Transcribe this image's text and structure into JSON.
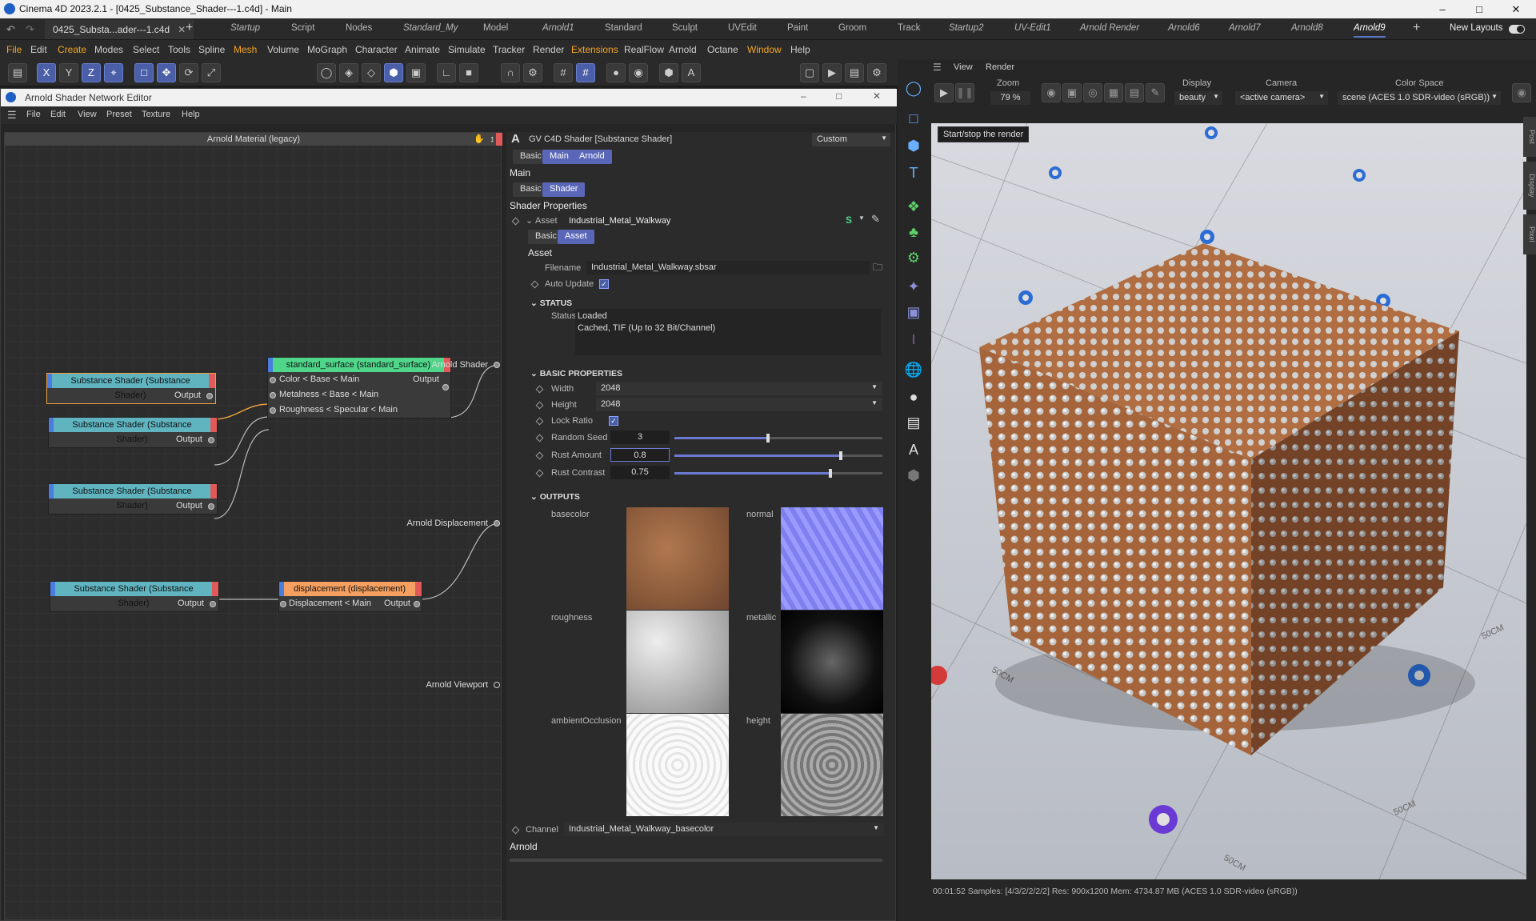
{
  "window": {
    "title": "Cinema 4D 2023.2.1 - [0425_Substance_Shader---1.c4d] - Main",
    "doc_tab": "0425_Substa...ader---1.c4d"
  },
  "layouts": [
    "Startup",
    "Script",
    "Nodes",
    "Standard_My",
    "Model",
    "Arnold1",
    "Standard",
    "Sculpt",
    "UVEdit",
    "Paint",
    "Groom",
    "Track",
    "Startup2",
    "UV-Edit1",
    "Arnold Render",
    "Arnold6",
    "Arnold7",
    "Arnold8",
    "Arnold9"
  ],
  "new_layouts": "New Layouts",
  "menu": [
    "File",
    "Edit",
    "Create",
    "Modes",
    "Select",
    "Tools",
    "Spline",
    "Mesh",
    "Volume",
    "MoGraph",
    "Character",
    "Animate",
    "Simulate",
    "Tracker",
    "Render",
    "Extensions",
    "RealFlow",
    "Arnold",
    "Octane",
    "Window",
    "Help"
  ],
  "editor": {
    "title": "Arnold Shader Network Editor",
    "menu": [
      "File",
      "Edit",
      "View",
      "Preset",
      "Texture",
      "Help"
    ],
    "graph_title": "Arnold Material (legacy)",
    "nodes": {
      "sub1": {
        "title": "Substance Shader (Substance Shader)",
        "out": "Output"
      },
      "sub2": {
        "title": "Substance Shader (Substance Shader)",
        "out": "Output"
      },
      "sub3": {
        "title": "Substance Shader (Substance Shader)",
        "out": "Output"
      },
      "sub4": {
        "title": "Substance Shader (Substance Shader)",
        "out": "Output"
      },
      "surface": {
        "title": "standard_surface (standard_surface)",
        "in1": "Color < Base < Main",
        "in2": "Metalness < Base < Main",
        "in3": "Roughness < Specular < Main",
        "out": "Output"
      },
      "disp": {
        "title": "displacement (displacement)",
        "in1": "Displacement < Main",
        "out": "Output"
      }
    },
    "outputs": {
      "shader": "Arnold Shader",
      "displacement": "Arnold Displacement",
      "viewport": "Arnold Viewport"
    }
  },
  "attr": {
    "header": "GV C4D Shader [Substance Shader]",
    "preset": "Custom",
    "tabs": [
      "Basic",
      "Main",
      "Arnold"
    ],
    "main_title": "Main",
    "sub_tabs": [
      "Basic",
      "Shader"
    ],
    "shader_props": "Shader Properties",
    "asset_label": "Asset",
    "asset_value": "Industrial_Metal_Walkway",
    "asset_tabs": [
      "Basic",
      "Asset"
    ],
    "asset_title": "Asset",
    "filename_label": "Filename",
    "filename": "Industrial_Metal_Walkway.sbsar",
    "auto_update": "Auto Update",
    "status_section": "STATUS",
    "status_label": "Status",
    "status_line1": "Loaded",
    "status_line2": "Cached, TIF (Up to 32 Bit/Channel)",
    "basic_section": "BASIC PROPERTIES",
    "width_label": "Width",
    "width": "2048",
    "height_label": "Height",
    "height": "2048",
    "lock_ratio": "Lock Ratio",
    "seed_label": "Random Seed",
    "seed": "3",
    "seed_frac": 0.45,
    "rust_label": "Rust Amount",
    "rust": "0.8",
    "rust_frac": 0.8,
    "contrast_label": "Rust Contrast",
    "contrast": "0.75",
    "contrast_frac": 0.75,
    "outputs_section": "OUTPUTS",
    "outputs": [
      "basecolor",
      "normal",
      "roughness",
      "metallic",
      "ambientOcclusion",
      "height"
    ],
    "channel_label": "Channel",
    "channel": "Industrial_Metal_Walkway_basecolor",
    "arnold_label": "Arnold"
  },
  "viewport": {
    "menu": [
      "View",
      "Render"
    ],
    "zoom_label": "Zoom",
    "zoom": "79 %",
    "display_label": "Display",
    "display": "beauty",
    "camera_label": "Camera",
    "camera": "<active camera>",
    "colorspace_label": "Color Space",
    "colorspace": "scene (ACES 1.0 SDR-video (sRGB))",
    "tooltip": "Start/stop the render",
    "status": "00:01:52  Samples: [4/3/2/2/2/2]  Res: 900x1200  Mem: 4734.87 MB  (ACES 1.0 SDR-video (sRGB))",
    "side_tabs": [
      "Post",
      "Display",
      "Pixel"
    ],
    "floor_label": "50CM"
  }
}
